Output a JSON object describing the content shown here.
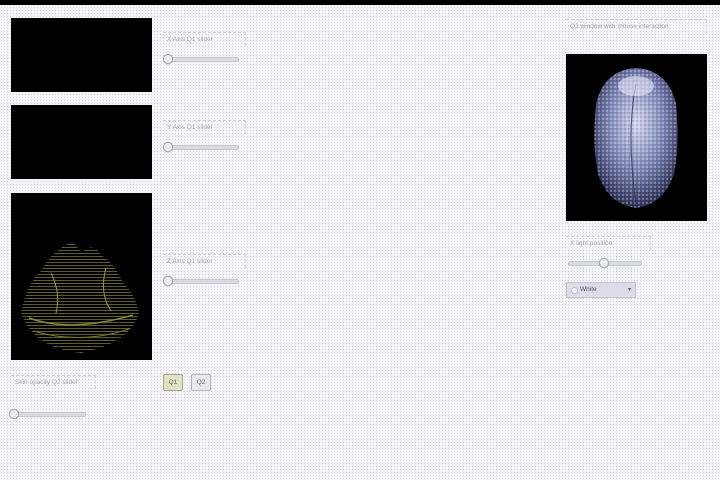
{
  "panels": {
    "top_view_alt": "",
    "middle_view_alt": "",
    "bottom_view_alt": "",
    "right_view_alt": ""
  },
  "sliders": {
    "x_axis": {
      "label": "X Axis Q1 slider",
      "value": 0.0
    },
    "y_axis": {
      "label": "Y Axis Q1 slider",
      "value": 0.0
    },
    "z_axis": {
      "label": "Z Axis Q1 slider",
      "value": 0.0
    },
    "opacity": {
      "label": "Skin opacity Q2 slider",
      "value": 0.0
    },
    "x_light": {
      "label": "X light position",
      "value": 0.5
    }
  },
  "buttons": {
    "q1": "Q1",
    "q2": "Q2"
  },
  "right_panel": {
    "header": "Q3 window with mouse interaction"
  },
  "color_select": {
    "selected": "White",
    "caret": "▾"
  },
  "colors": {
    "panel_bg": "#000000",
    "skull_tint": "#9aa4d6",
    "yellow_render": "#8a8a3a"
  }
}
